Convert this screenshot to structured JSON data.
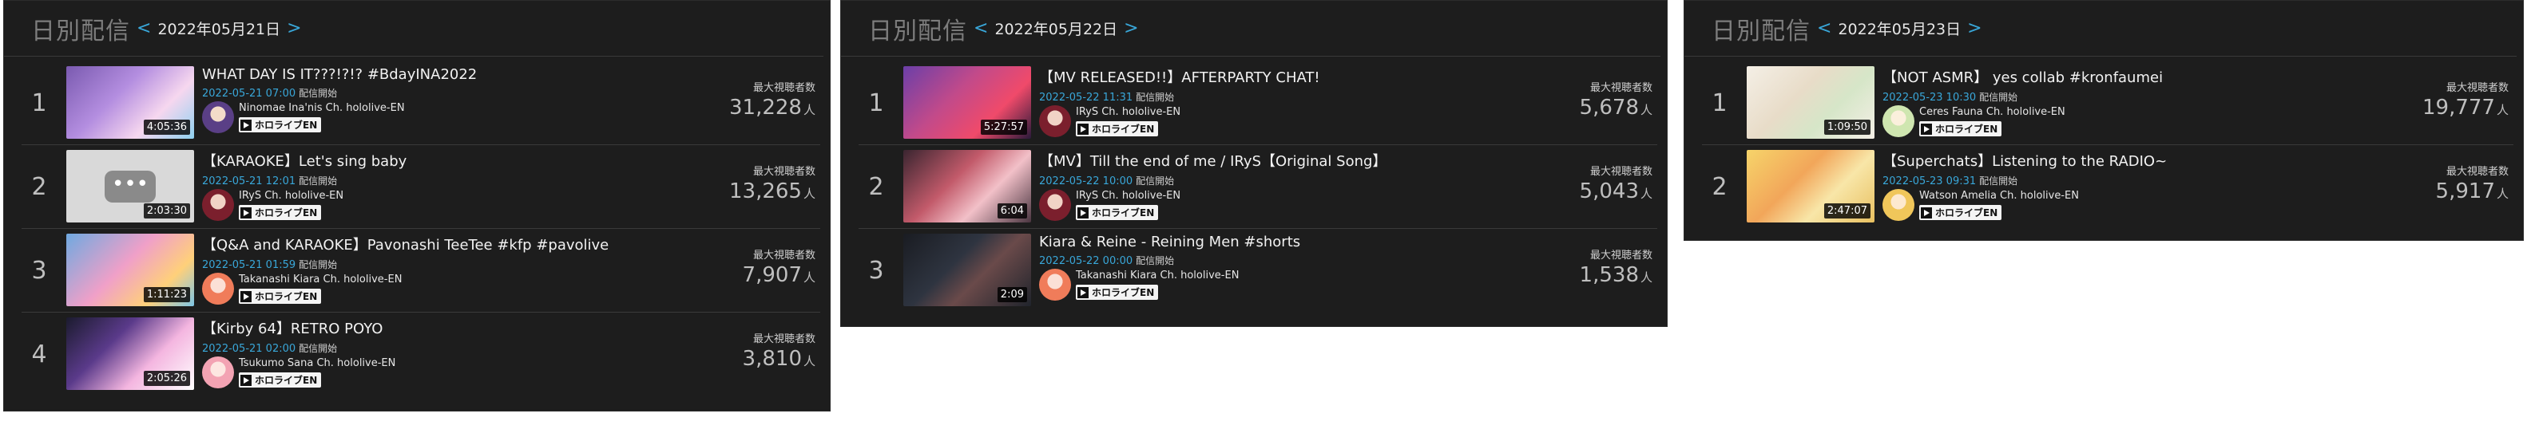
{
  "panel_title": "日別配信",
  "nav": {
    "prev": "<",
    "next": ">"
  },
  "panels": [
    {
      "date": "2022年05月21日",
      "videos": [
        {
          "rank": "1",
          "title": "WHAT DAY IS IT???!?!? #BdayINA2022",
          "time": "2022-05-21 07:00",
          "started": "配信開始",
          "channel": "Ninomae Ina'nis Ch. hololive-EN",
          "badge": "ホロライブEN",
          "duration": "4:05:36",
          "viewer_label": "最大視聴者数",
          "viewers": "31,228",
          "unit": "人"
        },
        {
          "rank": "2",
          "title": "【KARAOKE】Let's sing baby",
          "time": "2022-05-21 12:01",
          "started": "配信開始",
          "channel": "IRyS Ch. hololive-EN",
          "badge": "ホロライブEN",
          "duration": "2:03:30",
          "viewer_label": "最大視聴者数",
          "viewers": "13,265",
          "unit": "人"
        },
        {
          "rank": "3",
          "title": "【Q&A and KARAOKE】Pavonashi TeeTee #kfp #pavolive",
          "time": "2022-05-21 01:59",
          "started": "配信開始",
          "channel": "Takanashi Kiara Ch. hololive-EN",
          "badge": "ホロライブEN",
          "duration": "1:11:23",
          "viewer_label": "最大視聴者数",
          "viewers": "7,907",
          "unit": "人"
        },
        {
          "rank": "4",
          "title": "【Kirby 64】RETRO POYO",
          "time": "2022-05-21 02:00",
          "started": "配信開始",
          "channel": "Tsukumo Sana Ch. hololive-EN",
          "badge": "ホロライブEN",
          "duration": "2:05:26",
          "viewer_label": "最大視聴者数",
          "viewers": "3,810",
          "unit": "人"
        }
      ]
    },
    {
      "date": "2022年05月22日",
      "videos": [
        {
          "rank": "1",
          "title": "【MV RELEASED!!】AFTERPARTY CHAT!",
          "time": "2022-05-22 11:31",
          "started": "配信開始",
          "channel": "IRyS Ch. hololive-EN",
          "badge": "ホロライブEN",
          "duration": "5:27:57",
          "viewer_label": "最大視聴者数",
          "viewers": "5,678",
          "unit": "人"
        },
        {
          "rank": "2",
          "title": "【MV】Till the end of me / IRyS【Original Song】",
          "time": "2022-05-22 10:00",
          "started": "配信開始",
          "channel": "IRyS Ch. hololive-EN",
          "badge": "ホロライブEN",
          "duration": "6:04",
          "viewer_label": "最大視聴者数",
          "viewers": "5,043",
          "unit": "人"
        },
        {
          "rank": "3",
          "title": "Kiara & Reine - Reining Men #shorts",
          "time": "2022-05-22 00:00",
          "started": "配信開始",
          "channel": "Takanashi Kiara Ch. hololive-EN",
          "badge": "ホロライブEN",
          "duration": "2:09",
          "viewer_label": "最大視聴者数",
          "viewers": "1,538",
          "unit": "人"
        }
      ]
    },
    {
      "date": "2022年05月23日",
      "videos": [
        {
          "rank": "1",
          "title": "【NOT ASMR】 yes collab #kronfaumei",
          "time": "2022-05-23 10:30",
          "started": "配信開始",
          "channel": "Ceres Fauna Ch. hololive-EN",
          "badge": "ホロライブEN",
          "duration": "1:09:50",
          "viewer_label": "最大視聴者数",
          "viewers": "19,777",
          "unit": "人"
        },
        {
          "rank": "2",
          "title": "【Superchats】Listening to the RADIO~",
          "time": "2022-05-23 09:31",
          "started": "配信開始",
          "channel": "Watson Amelia Ch. hololive-EN",
          "badge": "ホロライブEN",
          "duration": "2:47:07",
          "viewer_label": "最大視聴者数",
          "viewers": "5,917",
          "unit": "人"
        }
      ]
    }
  ]
}
